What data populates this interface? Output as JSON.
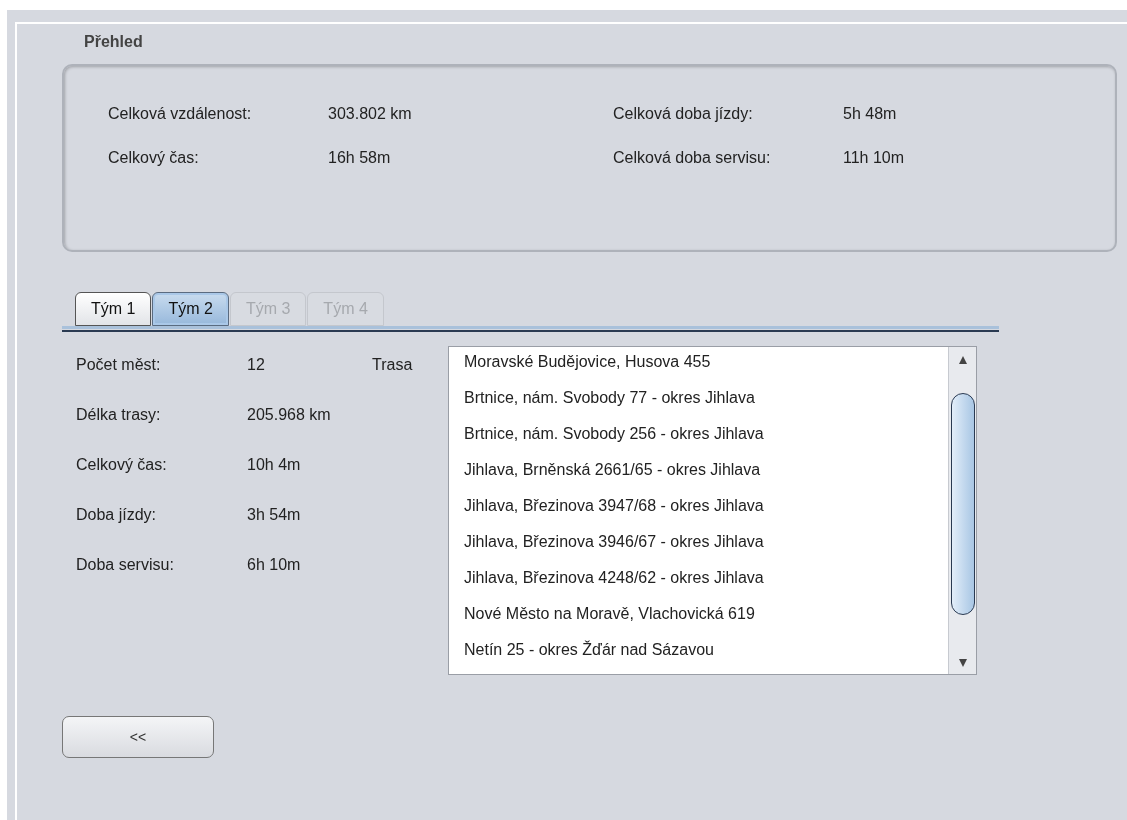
{
  "summary": {
    "title": "Přehled",
    "fields": [
      {
        "label": "Celková vzdálenost:",
        "value": "303.802 km"
      },
      {
        "label": "Celková doba jízdy:",
        "value": "5h 48m"
      },
      {
        "label": "Celkový čas:",
        "value": "16h 58m"
      },
      {
        "label": "Celková doba servisu:",
        "value": "11h 10m"
      }
    ]
  },
  "tabs": [
    {
      "label": "Tým 1",
      "selected": false,
      "disabled": false
    },
    {
      "label": "Tým 2",
      "selected": true,
      "disabled": false
    },
    {
      "label": "Tým 3",
      "selected": false,
      "disabled": true
    },
    {
      "label": "Tým 4",
      "selected": false,
      "disabled": true
    }
  ],
  "team": {
    "fields": [
      {
        "label": "Počet měst:",
        "value": "12"
      },
      {
        "label": "Délka trasy:",
        "value": "205.968 km"
      },
      {
        "label": "Celkový čas:",
        "value": "10h 4m"
      },
      {
        "label": "Doba jízdy:",
        "value": "3h 54m"
      },
      {
        "label": "Doba servisu:",
        "value": "6h 10m"
      }
    ],
    "route_label": "Trasa",
    "route": [
      "Moravské Budějovice, Husova 455",
      "Brtnice, nám. Svobody 77 - okres Jihlava",
      "Brtnice, nám. Svobody 256 - okres Jihlava",
      "Jihlava, Brněnská 2661/65 - okres Jihlava",
      "Jihlava, Březinova 3947/68 - okres Jihlava",
      "Jihlava, Březinova 3946/67 - okres Jihlava",
      "Jihlava, Březinova 4248/62 - okres Jihlava",
      "Nové Město na Moravě, Vlachovická 619",
      "Netín 25 - okres Žďár nad Sázavou"
    ]
  },
  "back_button": "<<"
}
